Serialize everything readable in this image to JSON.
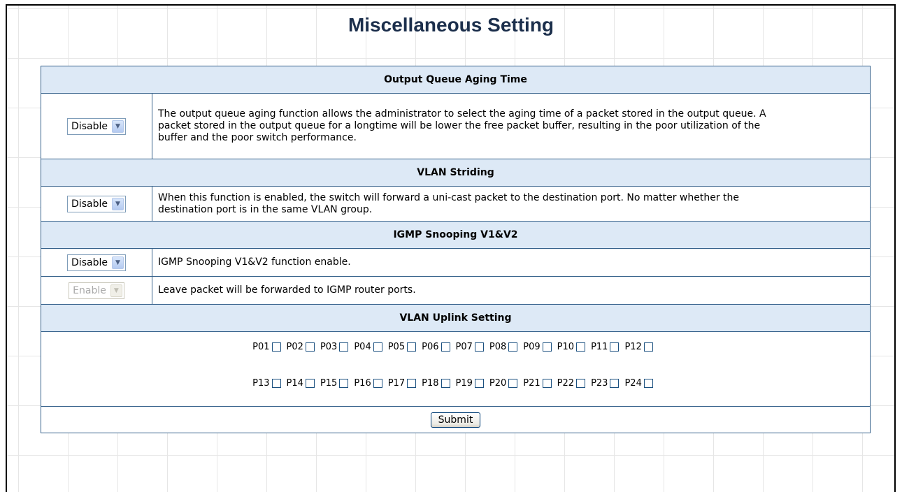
{
  "page": {
    "title": "Miscellaneous Setting"
  },
  "sections": {
    "output_queue": {
      "header": "Output Queue Aging Time",
      "select_value": "Disable",
      "description": "The output queue aging function allows the administrator to select the aging time of a packet stored in the output queue. A packet stored in the output queue for a longtime will be lower the free packet buffer, resulting in the poor utilization of the buffer and the poor switch performance."
    },
    "vlan_striding": {
      "header": "VLAN Striding",
      "select_value": "Disable",
      "description": "When this function is enabled, the switch will forward a uni-cast packet to the destination port. No matter whether the destination port is in the same VLAN group."
    },
    "igmp": {
      "header": "IGMP Snooping V1&V2",
      "select_value": "Disable",
      "description": "IGMP Snooping V1&V2 function enable.",
      "leave_select_value": "Enable",
      "leave_description": "Leave packet will be forwarded to IGMP router ports."
    },
    "uplink": {
      "header": "VLAN Uplink Setting",
      "ports_row1": [
        "P01",
        "P02",
        "P03",
        "P04",
        "P05",
        "P06",
        "P07",
        "P08",
        "P09",
        "P10",
        "P11",
        "P12"
      ],
      "ports_row2": [
        "P13",
        "P14",
        "P15",
        "P16",
        "P17",
        "P18",
        "P19",
        "P20",
        "P21",
        "P22",
        "P23",
        "P24"
      ]
    }
  },
  "submit_label": "Submit",
  "icons": {
    "dropdown": "chevron-down-icon"
  },
  "colors": {
    "header_bg": "#dde9f6",
    "header_text": "#2f5577",
    "border": "#34608a",
    "title": "#1c2f4c"
  }
}
